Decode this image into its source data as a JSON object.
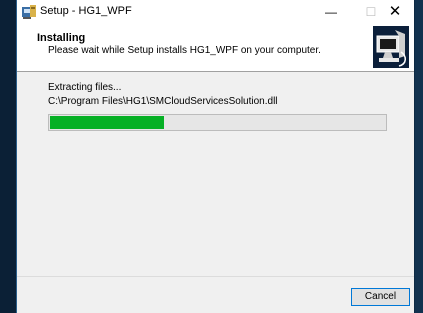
{
  "window": {
    "title": "Setup - HG1_WPF",
    "controls": {
      "minimize": "—",
      "maximize": "☐",
      "close": "✕"
    }
  },
  "header": {
    "title": "Installing",
    "subtitle": "Please wait while Setup installs HG1_WPF on your computer.",
    "image_icon": "setup-computer-icon"
  },
  "main": {
    "status": "Extracting files...",
    "current_file": "C:\\Program Files\\HG1\\SMCloudServicesSolution.dll",
    "progress_fraction": 0.34,
    "progress_color": "#06b025"
  },
  "footer": {
    "cancel_label": "Cancel"
  }
}
